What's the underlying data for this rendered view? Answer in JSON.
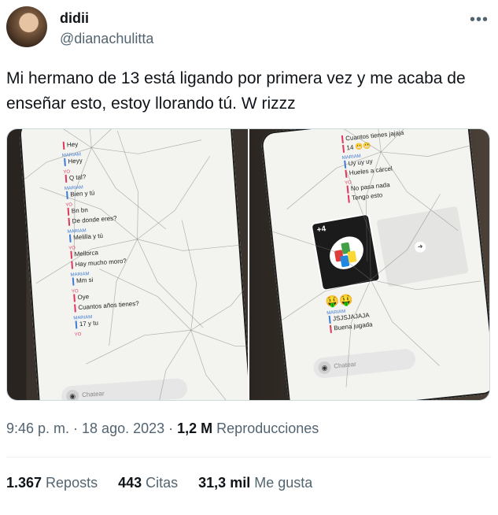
{
  "tweet": {
    "display_name": "didii",
    "handle": "@dianachulitta",
    "more_icon": "more-horizontal-icon",
    "text": "Mi hermano de 13 está ligando por primera vez y me acaba de enseñar esto, estoy llorando tú.  W rizzz"
  },
  "media": {
    "left_chat": [
      {
        "who": "",
        "text": "Hey"
      },
      {
        "who": "MARIAM",
        "text": "Heyy"
      },
      {
        "who": "YO",
        "text": "Q tal?"
      },
      {
        "who": "MARIAM",
        "text": "Bien y tú"
      },
      {
        "who": "YO",
        "text": "Bn bn"
      },
      {
        "who": "",
        "text": "De donde eres?"
      },
      {
        "who": "MARIAM",
        "text": "Melilla y tú"
      },
      {
        "who": "YO",
        "text": "Mellorca"
      },
      {
        "who": "",
        "text": "Hay mucho moro?"
      },
      {
        "who": "MARIAM",
        "text": "Mm si"
      },
      {
        "who": "YO",
        "text": "Oye"
      },
      {
        "who": "",
        "text": "Cuantos años tienes?"
      },
      {
        "who": "MARIAM",
        "text": "17 y tu"
      },
      {
        "who": "YO",
        "text": ""
      }
    ],
    "left_chat_placeholder": "Chatear",
    "right_chat": [
      {
        "who": "",
        "text": "Cuantos tienes jajaja"
      },
      {
        "who": "",
        "text": "14 😬😬"
      },
      {
        "who": "MARIAM",
        "text": "Uy uy uy"
      },
      {
        "who": "",
        "text": "Hueles a cárcel"
      },
      {
        "who": "YO",
        "text": "No pasa nada"
      },
      {
        "who": "",
        "text": "Tengo esto"
      }
    ],
    "uno_card_label": "+4",
    "emojis": "🤑🤑",
    "right_chat_after": [
      {
        "who": "MARIAM",
        "text": "JSJSJAJAJA"
      },
      {
        "who": "",
        "text": "Buena jugada"
      }
    ],
    "right_chat_placeholder": "Chatear"
  },
  "meta": {
    "time": "9:46 p. m. · 18 ago. 2023 · ",
    "views_count": "1,2 M",
    "views_label": " Reproducciones"
  },
  "stats": {
    "reposts_count": "1.367",
    "reposts_label": " Reposts",
    "quotes_count": "443",
    "quotes_label": " Citas",
    "likes_count": "31,3 mil",
    "likes_label": " Me gusta"
  }
}
